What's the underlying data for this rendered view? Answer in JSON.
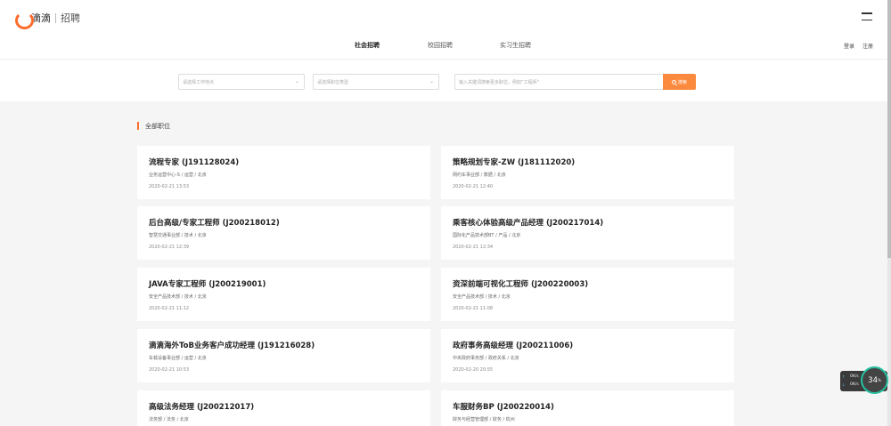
{
  "header": {
    "brand": "滴滴",
    "subtitle": "招聘",
    "accent": "#fc6d2e"
  },
  "tabs": [
    {
      "label": "社会招聘",
      "active": true
    },
    {
      "label": "校园招聘",
      "active": false
    },
    {
      "label": "实习生招聘",
      "active": false
    }
  ],
  "auth": {
    "login": "登录",
    "register": "注册"
  },
  "filters": {
    "location_placeholder": "请选择工作地点",
    "type_placeholder": "请选择职位类型",
    "search_placeholder": "输入关键词搜索更多职位，例如“工程师”",
    "search_button": "搜索"
  },
  "section": {
    "title": "全部职位"
  },
  "jobs": [
    {
      "title": "流程专家 (J191128024)",
      "meta": "业务运营中心-S / 运营 / 北京",
      "date": "2020-02-21 13:53"
    },
    {
      "title": "策略规划专家-ZW (J181112020)",
      "meta": "网约车事业部 / 数据 / 北京",
      "date": "2020-02-21 12:40"
    },
    {
      "title": "后台高级/专家工程师 (J200218012)",
      "meta": "智慧交通事业部 / 技术 / 北京",
      "date": "2020-02-21 12:39"
    },
    {
      "title": "乘客核心体验高级产品经理 (J200217014)",
      "meta": "国际化产品技术部BT / 产品 / 北京",
      "date": "2020-02-21 12:34"
    },
    {
      "title": "JAVA专家工程师 (J200219001)",
      "meta": "安全产品技术部 / 技术 / 北京",
      "date": "2020-02-21 11:12"
    },
    {
      "title": "资深前端可视化工程师 (J200220003)",
      "meta": "安全产品技术部 / 技术 / 北京",
      "date": "2020-02-21 11:08"
    },
    {
      "title": "滴滴海外ToB业务客户成功经理 (J191216028)",
      "meta": "车载设备事业部 / 运营 / 北京",
      "date": "2020-02-21 10:53"
    },
    {
      "title": "政府事务高级经理 (J200211006)",
      "meta": "中央政府事务部 / 政府关系 / 北京",
      "date": "2020-02-20 20:55"
    },
    {
      "title": "高级法务经理 (J200212017)",
      "meta": "法务部 / 法务 / 北京",
      "date": ""
    },
    {
      "title": "车服财务BP (J200220014)",
      "meta": "财务与经营管理部 / 财务 / 杭州",
      "date": ""
    }
  ],
  "overlay": {
    "upload": "0K/s",
    "download": "0K/s",
    "percent": "34",
    "percent_unit": "%"
  }
}
